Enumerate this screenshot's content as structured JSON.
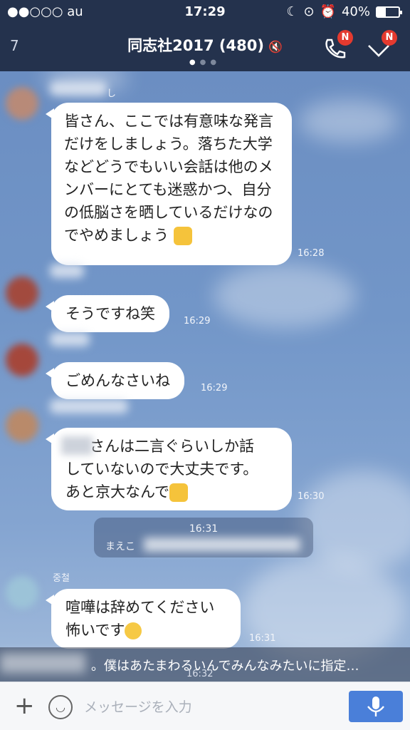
{
  "status_bar": {
    "carrier": "●●○○○ au",
    "time": "17:29",
    "battery": "40%",
    "battery_level": 0.4
  },
  "header": {
    "back_label": "7",
    "title": "同志社2017 (480)",
    "call_badge": "N",
    "menu_badge": "N"
  },
  "messages": [
    {
      "name_tail": "し",
      "text": "皆さん、ここでは有意味な発言だけをしましょう。落ちた大学などどうでもいい会話は他のメンバーにとても迷惑かつ、自分の低脳さを晒しているだけなのでやめましょう",
      "emoji": "thumbs-up-icon",
      "time": "16:28"
    },
    {
      "text": "そうですね笑",
      "time": "16:29"
    },
    {
      "text": "ごめんなさいね",
      "time": "16:29"
    },
    {
      "text_line1": "さんは二言ぐらいしか話",
      "text_line2": "していないので大丈夫です。",
      "text_line3": "あと京大なんで",
      "emoji": "thumbs-up-icon",
      "time": "16:30"
    },
    {
      "name": "중철",
      "text_line1": "喧嘩は辞めてください",
      "text_line2": "怖いです",
      "emoji": "crying-face-icon",
      "time": "16:31"
    }
  ],
  "notice": {
    "time": "16:31",
    "text_start": "まえこ"
  },
  "preview": {
    "text": "。僕はあたまわるいんでみんなみたいに指定…",
    "time": "16:32"
  },
  "input": {
    "placeholder": "メッセージを入力"
  }
}
